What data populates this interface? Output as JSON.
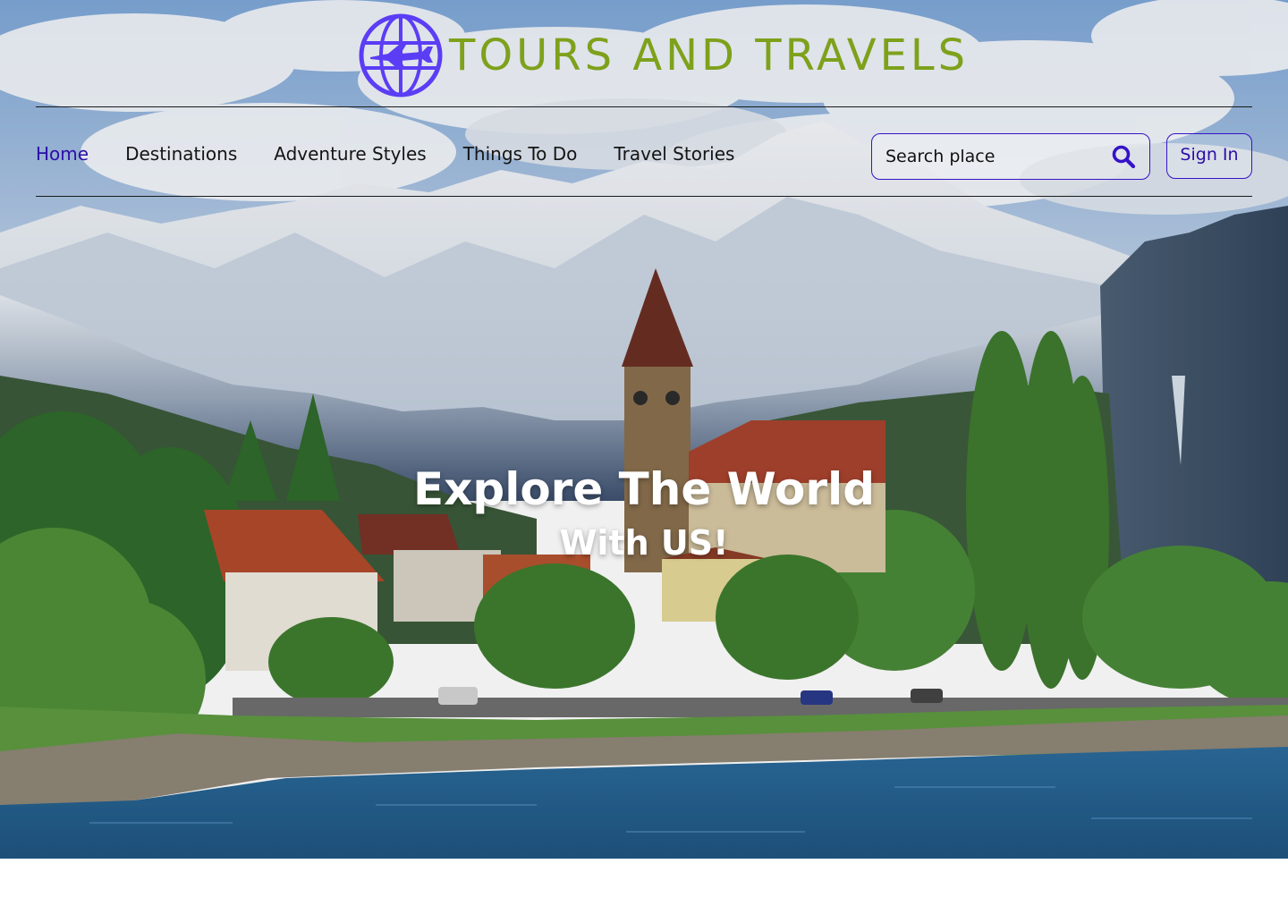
{
  "brand": {
    "name": "TOURS AND TRAVELS",
    "logo_icon": "globe-airplane-icon",
    "name_color": "#7ea11b",
    "logo_color": "#5b3df5"
  },
  "nav": {
    "items": [
      {
        "label": "Home",
        "active": true
      },
      {
        "label": "Destinations",
        "active": false
      },
      {
        "label": "Adventure Styles",
        "active": false
      },
      {
        "label": "Things To Do",
        "active": false
      },
      {
        "label": "Travel Stories",
        "active": false
      }
    ],
    "active_color": "#2b0ea8"
  },
  "search": {
    "placeholder": "Search place",
    "icon": "search-icon"
  },
  "signin": {
    "label": "Sign In"
  },
  "hero": {
    "title": "Explore The World",
    "subtitle": "With US!",
    "background": "mountain-lake-village-photo"
  },
  "colors": {
    "accent": "#3512c8",
    "sky": "#8fb3dc",
    "water": "#2f6a9a"
  }
}
